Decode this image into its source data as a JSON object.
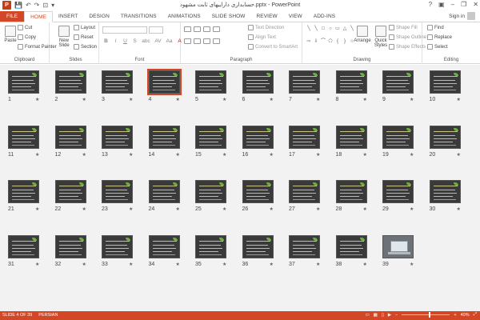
{
  "window": {
    "title": "حسابداری داراییهای ثابت مشهود.pptx - PowerPoint",
    "app_icon": "P",
    "help": "?",
    "controls": [
      "▣",
      "–",
      "❐",
      "✕"
    ]
  },
  "qat": [
    "💾",
    "↶",
    "↷",
    "⊡",
    "▾"
  ],
  "tabs": [
    "FILE",
    "HOME",
    "INSERT",
    "DESIGN",
    "TRANSITIONS",
    "ANIMATIONS",
    "SLIDE SHOW",
    "REVIEW",
    "VIEW",
    "ADD-INS"
  ],
  "active_tab": "HOME",
  "signin": "Sign in",
  "ribbon": {
    "clipboard": {
      "label": "Clipboard",
      "paste": "Paste",
      "cut": "Cut",
      "copy": "Copy",
      "format_painter": "Format Painter"
    },
    "slides": {
      "label": "Slides",
      "new_slide": "New Slide",
      "layout": "Layout",
      "reset": "Reset",
      "section": "Section"
    },
    "font": {
      "label": "Font",
      "bold": "B",
      "italic": "I",
      "underline": "U",
      "strike": "S",
      "shadow": "abc",
      "spacing": "AV",
      "case": "Aa",
      "color": "A"
    },
    "paragraph": {
      "label": "Paragraph",
      "text_direction": "Text Direction",
      "align_text": "Align Text",
      "convert_smartart": "Convert to SmartArt"
    },
    "drawing": {
      "label": "Drawing",
      "arrange": "Arrange",
      "quick_styles": "Quick Styles",
      "shape_fill": "Shape Fill",
      "shape_outline": "Shape Outline",
      "shape_effects": "Shape Effects"
    },
    "editing": {
      "label": "Editing",
      "find": "Find",
      "replace": "Replace",
      "select": "Select"
    }
  },
  "slides": {
    "selected": 4,
    "items": [
      {
        "num": "1",
        "photo": false
      },
      {
        "num": "2",
        "photo": false
      },
      {
        "num": "3",
        "photo": false
      },
      {
        "num": "4",
        "photo": false
      },
      {
        "num": "5",
        "photo": false
      },
      {
        "num": "6",
        "photo": false
      },
      {
        "num": "7",
        "photo": false
      },
      {
        "num": "8",
        "photo": false
      },
      {
        "num": "9",
        "photo": false
      },
      {
        "num": "10",
        "photo": false
      },
      {
        "num": "11",
        "photo": false
      },
      {
        "num": "12",
        "photo": false
      },
      {
        "num": "13",
        "photo": false
      },
      {
        "num": "14",
        "photo": false
      },
      {
        "num": "15",
        "photo": false
      },
      {
        "num": "16",
        "photo": false
      },
      {
        "num": "17",
        "photo": false
      },
      {
        "num": "18",
        "photo": false
      },
      {
        "num": "19",
        "photo": false
      },
      {
        "num": "20",
        "photo": false
      },
      {
        "num": "21",
        "photo": false
      },
      {
        "num": "22",
        "photo": false
      },
      {
        "num": "23",
        "photo": false
      },
      {
        "num": "24",
        "photo": false
      },
      {
        "num": "25",
        "photo": false
      },
      {
        "num": "26",
        "photo": false
      },
      {
        "num": "27",
        "photo": false
      },
      {
        "num": "28",
        "photo": false
      },
      {
        "num": "29",
        "photo": false
      },
      {
        "num": "30",
        "photo": false
      },
      {
        "num": "31",
        "photo": false
      },
      {
        "num": "32",
        "photo": false
      },
      {
        "num": "33",
        "photo": false
      },
      {
        "num": "34",
        "photo": false
      },
      {
        "num": "35",
        "photo": false
      },
      {
        "num": "36",
        "photo": false
      },
      {
        "num": "37",
        "photo": false
      },
      {
        "num": "38",
        "photo": false
      },
      {
        "num": "39",
        "photo": true
      }
    ],
    "star": "★"
  },
  "status": {
    "slide_of": "SLIDE 4 OF 39",
    "language": "PERSIAN",
    "zoom": "40%",
    "zoom_fraction": 0.4
  },
  "colors": {
    "accent": "#d24726"
  }
}
